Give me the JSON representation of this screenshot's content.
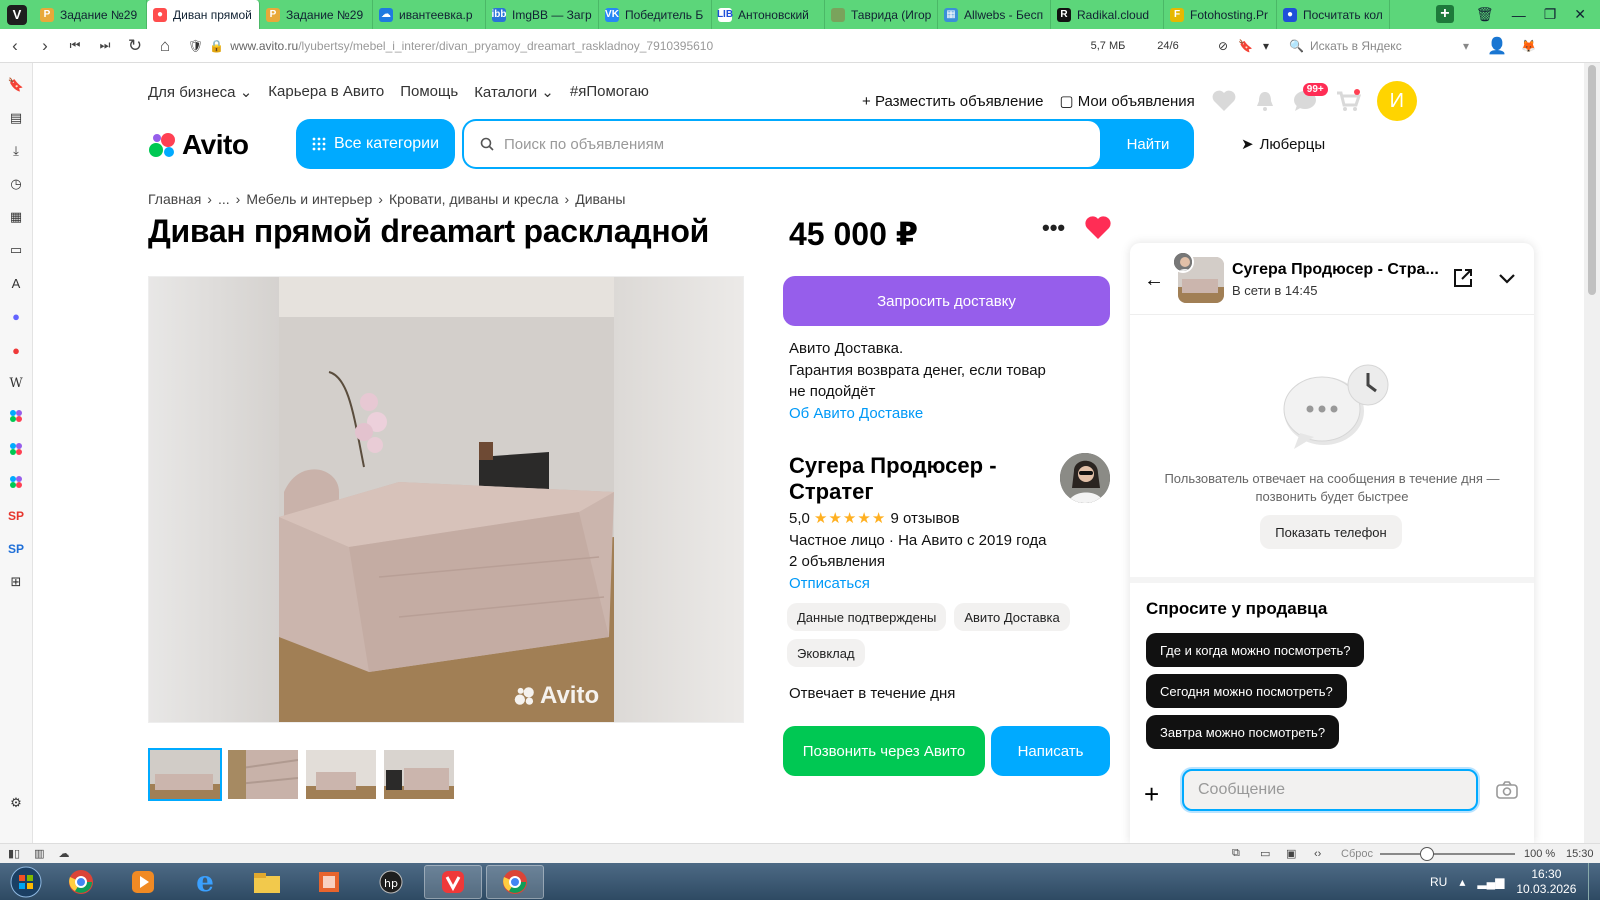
{
  "browser": {
    "tabs": [
      {
        "label": "Задание №29",
        "fav": "P",
        "color": "#e8a93a",
        "active": false
      },
      {
        "label": "Диван прямой",
        "fav": "●",
        "color": "#ff4d4d",
        "active": true
      },
      {
        "label": "Задание №29",
        "fav": "P",
        "color": "#e8a93a",
        "active": false
      },
      {
        "label": "ивантеевка.р",
        "fav": "☁",
        "color": "#1f7ae0",
        "active": false
      },
      {
        "label": "ImgBB — Загр",
        "fav": "ibb",
        "color": "#2a73d8",
        "active": false
      },
      {
        "label": "Победитель Б",
        "fav": "VK",
        "color": "#2787f5",
        "active": false
      },
      {
        "label": "Антоновский",
        "fav": "LIB",
        "color": "#ffffff",
        "active": false
      },
      {
        "label": "Таврида (Игор",
        "fav": "",
        "color": "#7aa35c",
        "active": false
      },
      {
        "label": "Allwebs - Бесп",
        "fav": "▦",
        "color": "#3a8fd8",
        "active": false
      },
      {
        "label": "Radikal.cloud",
        "fav": "R",
        "color": "#111111",
        "active": false
      },
      {
        "label": "Fotohosting.Pr",
        "fav": "F",
        "color": "#e6b800",
        "active": false
      },
      {
        "label": "Посчитать кол",
        "fav": "●",
        "color": "#1f4fd8",
        "active": false
      }
    ],
    "url_host": "www.avito.ru",
    "url_path": "/lyubertsy/mebel_i_interer/divan_pryamoy_dreamart_raskladnoy_7910395610",
    "page_size": "5,7 МБ",
    "tab_count": "24/6",
    "search_placeholder": "Искать в Яндекс",
    "vivaldi_letter": "V"
  },
  "header": {
    "links": [
      "Для бизнеса",
      "Карьера в Авито",
      "Помощь",
      "Каталоги",
      "#яПомогаю"
    ],
    "post_ad": "Разместить объявление",
    "my_ads": "Мои объявления",
    "messages_badge": "99+",
    "user_initial": "И",
    "logo_text": "Avito",
    "all_categories": "Все категории",
    "search_placeholder": "Поиск по объявлениям",
    "find": "Найти",
    "city": "Люберцы"
  },
  "listing": {
    "breadcrumbs": [
      "Главная",
      "...",
      "Мебель и интерьер",
      "Кровати, диваны и кресла",
      "Диваны"
    ],
    "title": "Диван прямой dreamart раскладной",
    "price": "45 000 ₽",
    "watermark": "Avito",
    "delivery_button": "Запросить доставку",
    "delivery_lines": [
      "Авито Доставка.",
      "Гарантия возврата денег, если товар",
      "не подойдёт"
    ],
    "delivery_link": "Об Авито Доставке",
    "seller_name_1": "Сугера Продюсер -",
    "seller_name_2": "Стратег",
    "rating": "5,0",
    "stars": "★★★★★",
    "reviews": "9 отзывов",
    "seller_type": "Частное лицо · На Авито с 2019 года",
    "ads_count": "2 объявления",
    "unsubscribe": "Отписаться",
    "chips": [
      "Данные подтверждены",
      "Авито Доставка",
      "Эковклад"
    ],
    "responds": "Отвечает в течение дня",
    "call_button": "Позвонить через Авито",
    "write_button": "Написать"
  },
  "chat": {
    "name": "Сугера Продюсер - Стра...",
    "status": "В сети в 14:45",
    "note": "Пользователь отвечает на сообщения в течение дня — позвонить будет быстрее",
    "show_phone": "Показать телефон",
    "ask_title": "Спросите у продавца",
    "questions": [
      "Где и когда можно посмотреть?",
      "Сегодня можно посмотреть?",
      "Завтра можно посмотреть?"
    ],
    "message_placeholder": "Сообщение"
  },
  "statusbar": {
    "reset": "Сброс",
    "zoom": "100 %",
    "time": "15:30",
    "zoom_fraction": 0.35
  },
  "taskbar": {
    "lang": "RU",
    "clock_time": "16:30",
    "clock_date": "10.03.2026"
  },
  "colors": {
    "browser_chrome": "#5cd67a",
    "avito_blue": "#00aaff",
    "delivery_purple": "#965eeb",
    "call_green": "#00c853",
    "favorite_red": "#ff2d55"
  }
}
